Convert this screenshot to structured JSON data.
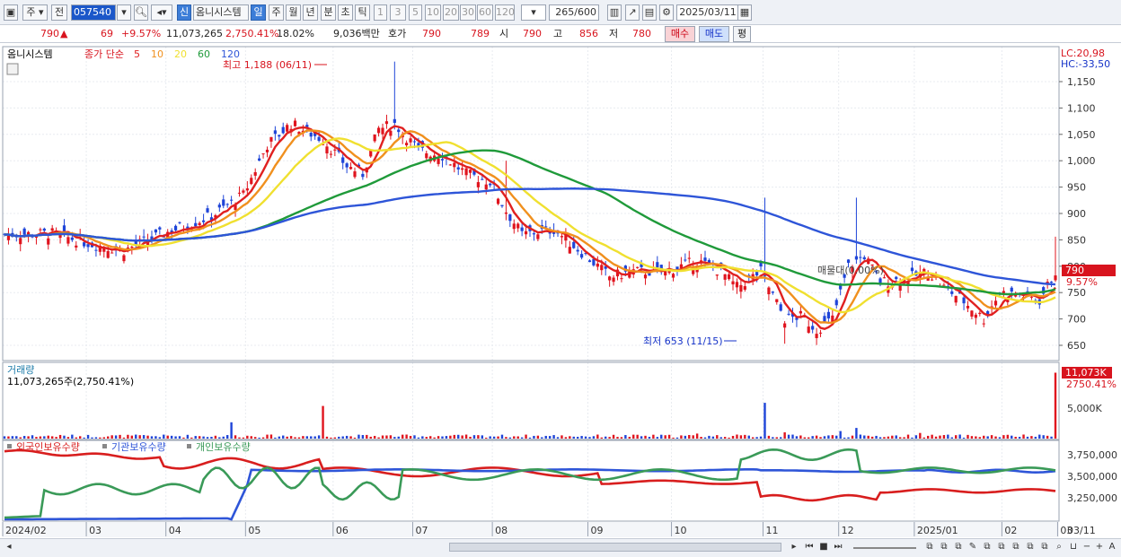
{
  "toolbar": {
    "market": "주",
    "mode": "전",
    "code": "057540",
    "new_badge": "신",
    "stock_name": "옴니시스템",
    "periods": [
      "일",
      "주",
      "월",
      "년",
      "분",
      "초",
      "틱"
    ],
    "active_period": "일",
    "intervals": [
      "1",
      "3",
      "5",
      "10",
      "20",
      "30",
      "60",
      "120"
    ],
    "count": "265",
    "count_total": "/600",
    "date": "2025/03/11"
  },
  "quote": {
    "price": "790",
    "change_arrow": "▲",
    "change": "69",
    "change_pct": "+9.57%",
    "volume": "11,073,265",
    "volume_pct": "2,750.41%",
    "turnover": "18.02%",
    "amount": "9,036백만",
    "bid_label": "호가",
    "ask": "790",
    "bid": "789",
    "open_label": "시",
    "open": "790",
    "high_label": "고",
    "high": "856",
    "low_label": "저",
    "low": "780",
    "buy_button": "매수",
    "sell_button": "매도",
    "eval_button": "평"
  },
  "price_pane": {
    "legend_name": "옴니시스템",
    "ma_label": "종가 단순",
    "ma_periods": [
      "5",
      "10",
      "20",
      "60",
      "120"
    ],
    "ma_colors": [
      "#e02020",
      "#f0901e",
      "#f0e030",
      "#1f9a3a",
      "#2e55d8"
    ],
    "high_note": "최고 1,188 (06/11)",
    "low_note": "최저 653 (11/15)",
    "lc": "LC:20,98",
    "hc": "HC:-33,50",
    "current_tag": "790",
    "current_pct": "9.57%",
    "overlay_text": "매물대(0.00%)",
    "y_ticks": [
      "1,150",
      "1,100",
      "1,050",
      "1,000",
      "950",
      "900",
      "850",
      "800",
      "750",
      "700",
      "650"
    ]
  },
  "volume_pane": {
    "title": "거래량",
    "value": "11,073,265주(2,750.41%)",
    "tag": "11,073K",
    "tag_pct": "2750.41%",
    "y_ticks": [
      "5,000K"
    ]
  },
  "holding_pane": {
    "legends": [
      "외국인보유수량",
      "기관보유수량",
      "개인보유수량"
    ],
    "colors": [
      "#d81e1e",
      "#2e55d8",
      "#3a9a58"
    ],
    "y_ticks": [
      "3,750,000",
      "3,500,000",
      "3,250,000"
    ]
  },
  "x_axis": {
    "labels": [
      "2024/02",
      "03",
      "04",
      "05",
      "06",
      "07",
      "08",
      "09",
      "10",
      "11",
      "12",
      "2025/01",
      "02",
      "03"
    ],
    "right_label": "03/11"
  }
}
